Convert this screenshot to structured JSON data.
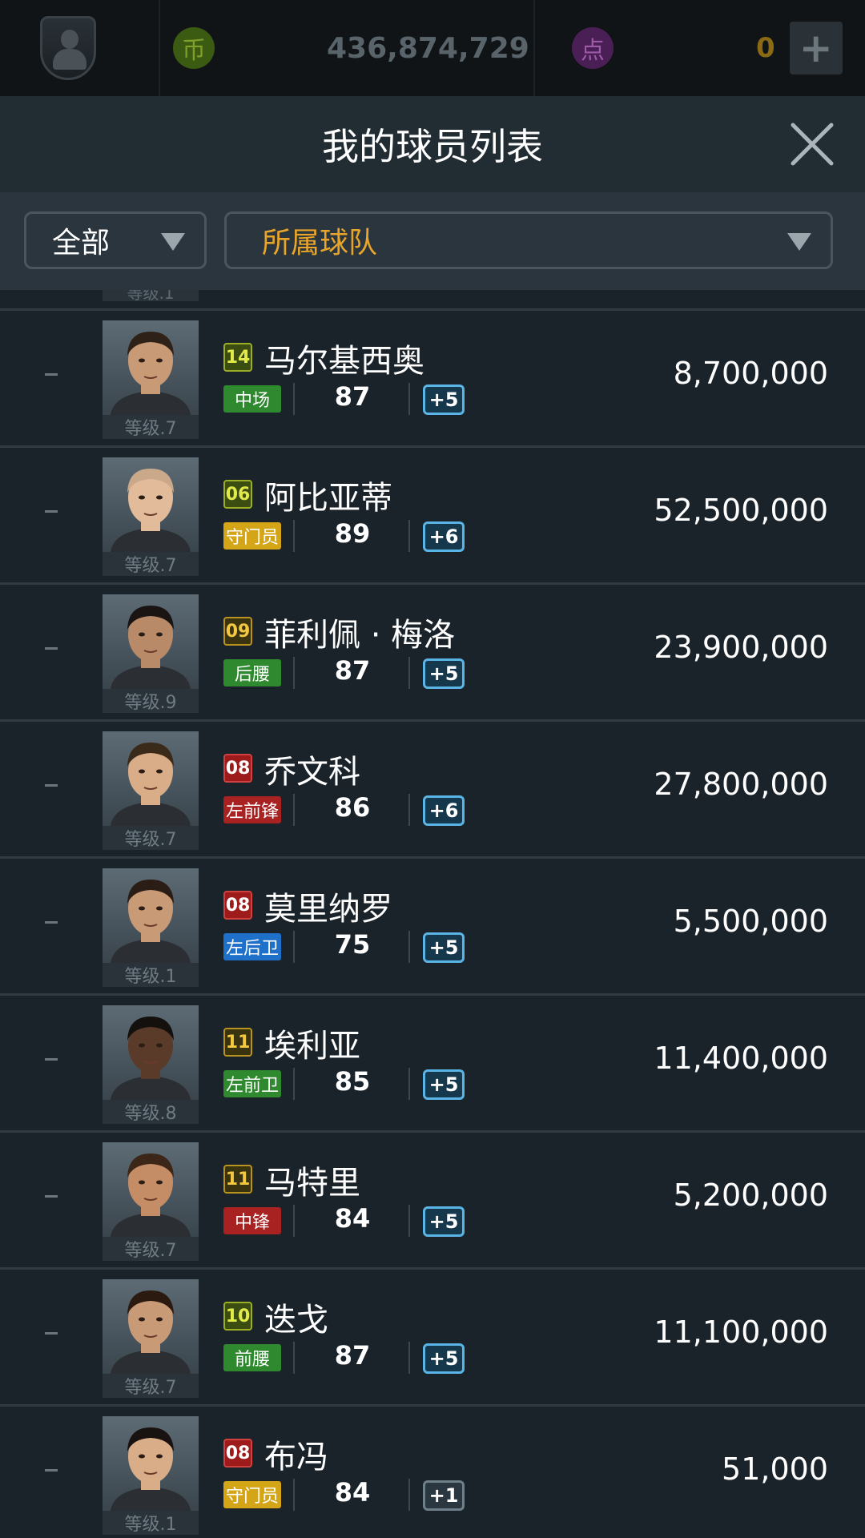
{
  "topbar": {
    "coin_icon_text": "币",
    "coins": "436,874,729",
    "point_icon_text": "点",
    "points": "0",
    "plus_label": "+"
  },
  "header": {
    "title": "我的球员列表"
  },
  "filters": {
    "position": "全部",
    "team": "所属球队"
  },
  "peek_level": "等级.1",
  "players": [
    {
      "number": "14",
      "badge": "green",
      "name": "马尔基西奥",
      "position": "中场",
      "pos_color": "mid",
      "ovr": "87",
      "plus": "+5",
      "plus_style": "on",
      "level": "等级.7",
      "value": "8,700,000"
    },
    {
      "number": "06",
      "badge": "green",
      "name": "阿比亚蒂",
      "position": "守门员",
      "pos_color": "gk",
      "ovr": "89",
      "plus": "+6",
      "plus_style": "on",
      "level": "等级.7",
      "value": "52,500,000"
    },
    {
      "number": "09",
      "badge": "gold",
      "name": "菲利佩 · 梅洛",
      "position": "后腰",
      "pos_color": "mid",
      "ovr": "87",
      "plus": "+5",
      "plus_style": "on",
      "level": "等级.9",
      "value": "23,900,000"
    },
    {
      "number": "08",
      "badge": "red",
      "name": "乔文科",
      "position": "左前锋",
      "pos_color": "fw",
      "ovr": "86",
      "plus": "+6",
      "plus_style": "on",
      "level": "等级.7",
      "value": "27,800,000"
    },
    {
      "number": "08",
      "badge": "red",
      "name": "莫里纳罗",
      "position": "左后卫",
      "pos_color": "def",
      "ovr": "75",
      "plus": "+5",
      "plus_style": "on",
      "level": "等级.1",
      "value": "5,500,000"
    },
    {
      "number": "11",
      "badge": "gold",
      "name": "埃利亚",
      "position": "左前卫",
      "pos_color": "mid",
      "ovr": "85",
      "plus": "+5",
      "plus_style": "on",
      "level": "等级.8",
      "value": "11,400,000"
    },
    {
      "number": "11",
      "badge": "gold",
      "name": "马特里",
      "position": "中锋",
      "pos_color": "fw",
      "ovr": "84",
      "plus": "+5",
      "plus_style": "on",
      "level": "等级.7",
      "value": "5,200,000"
    },
    {
      "number": "10",
      "badge": "green",
      "name": "迭戈",
      "position": "前腰",
      "pos_color": "mid",
      "ovr": "87",
      "plus": "+5",
      "plus_style": "on",
      "level": "等级.7",
      "value": "11,100,000"
    },
    {
      "number": "08",
      "badge": "red",
      "name": "布冯",
      "position": "守门员",
      "pos_color": "gk",
      "ovr": "84",
      "plus": "+1",
      "plus_style": "dim",
      "level": "等级.1",
      "value": "51,000"
    }
  ],
  "skin_tones": [
    "#c99a76",
    "#e2bb9b",
    "#b88a68",
    "#d9ad88",
    "#c99a76",
    "#5a3a28",
    "#c48d66",
    "#c99a76",
    "#d9ad88"
  ],
  "hair_tones": [
    "#2e2118",
    "#c9a98a",
    "#1a1512",
    "#3a2a1a",
    "#2a1d15",
    "#14100d",
    "#3b2618",
    "#2a1a10",
    "#181210"
  ]
}
